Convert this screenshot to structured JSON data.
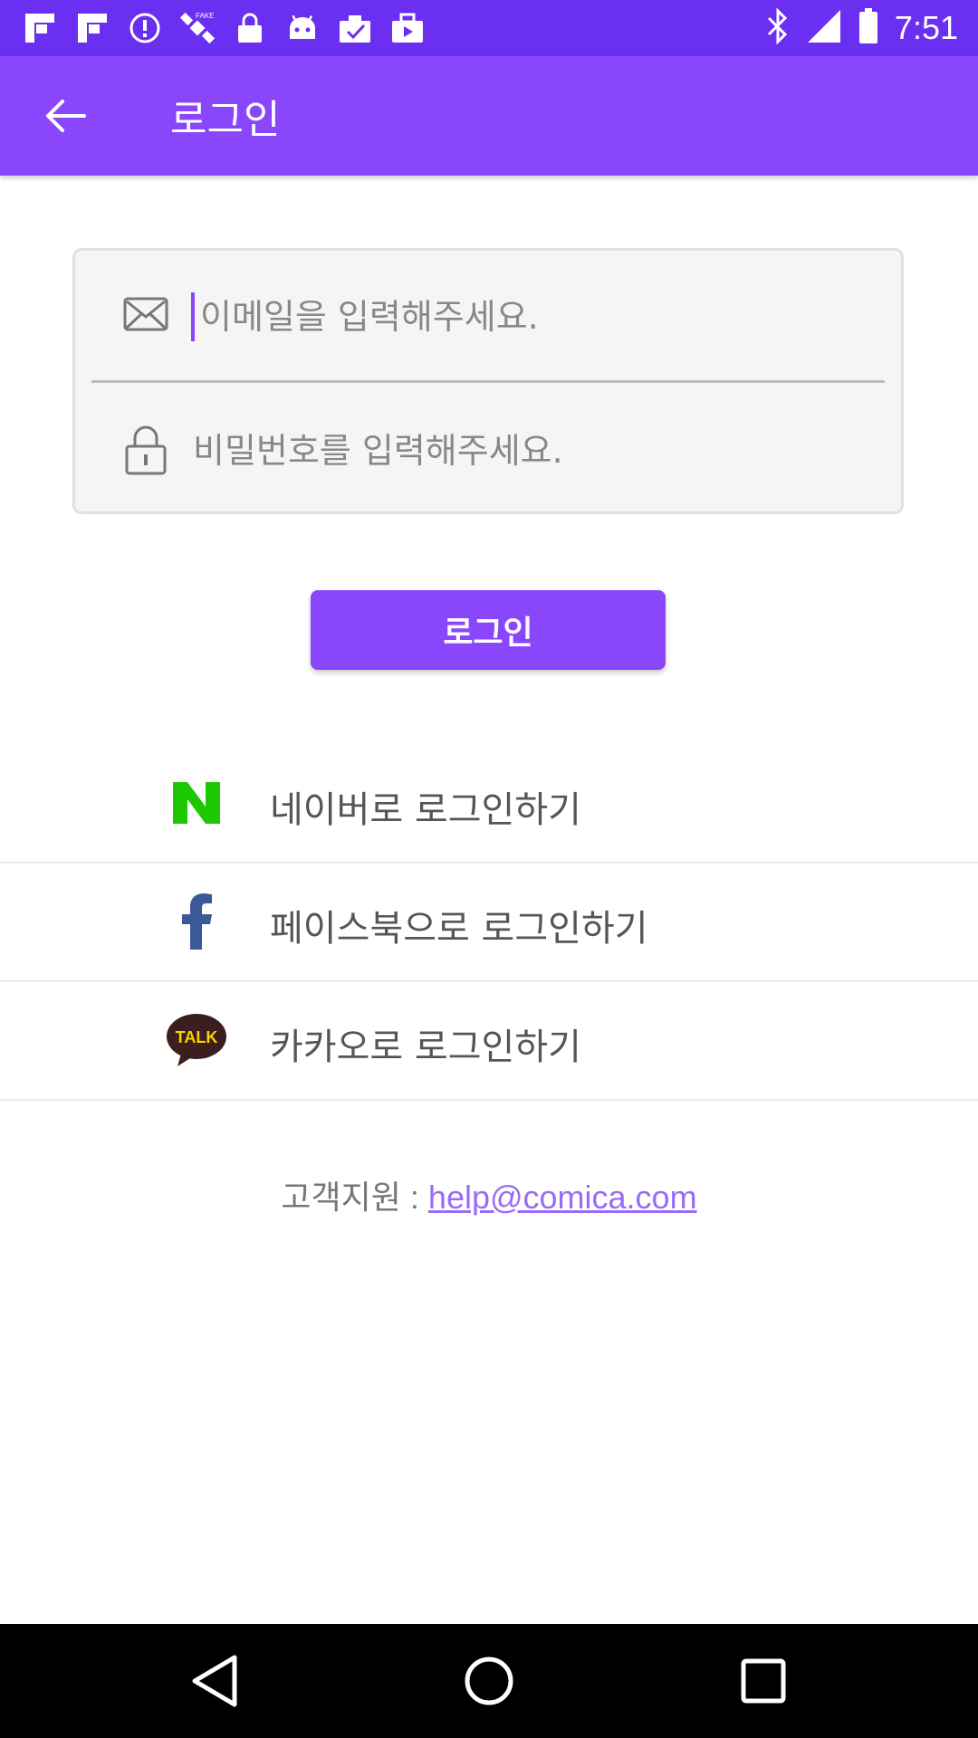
{
  "status_bar": {
    "time": "7:51",
    "left_icons": [
      "flipboard-icon",
      "flipboard-icon",
      "alert-circle-icon",
      "fake-gps-satellite-icon",
      "lock-icon",
      "android-icon",
      "clipboard-check-icon",
      "briefcase-play-icon"
    ],
    "right_icons": [
      "bluetooth-icon",
      "signal-icon",
      "battery-icon"
    ]
  },
  "app_bar": {
    "title": "로그인",
    "back_icon": "arrow-left-icon"
  },
  "form": {
    "email": {
      "icon": "envelope-icon",
      "placeholder": "이메일을 입력해주세요."
    },
    "password": {
      "icon": "lock-icon",
      "placeholder": "비밀번호를 입력해주세요."
    }
  },
  "login_button": {
    "label": "로그인"
  },
  "social_logins": [
    {
      "icon": "naver-icon",
      "label": "네이버로 로그인하기",
      "color": "#1ec800"
    },
    {
      "icon": "facebook-icon",
      "label": "페이스북으로 로그인하기",
      "color": "#3b5998"
    },
    {
      "icon": "kakaotalk-icon",
      "label": "카카오로 로그인하기",
      "color": "#3c1e1e"
    }
  ],
  "support": {
    "label": "고객지원 : ",
    "email": "help@comica.com"
  },
  "nav_bar": {
    "buttons": [
      "back-triangle-icon",
      "home-circle-icon",
      "recents-square-icon"
    ]
  },
  "colors": {
    "status_bar": "#6a2ff0",
    "app_bar": "#8a46fb",
    "accent": "#8a46fb",
    "link": "#9b6bf5"
  }
}
